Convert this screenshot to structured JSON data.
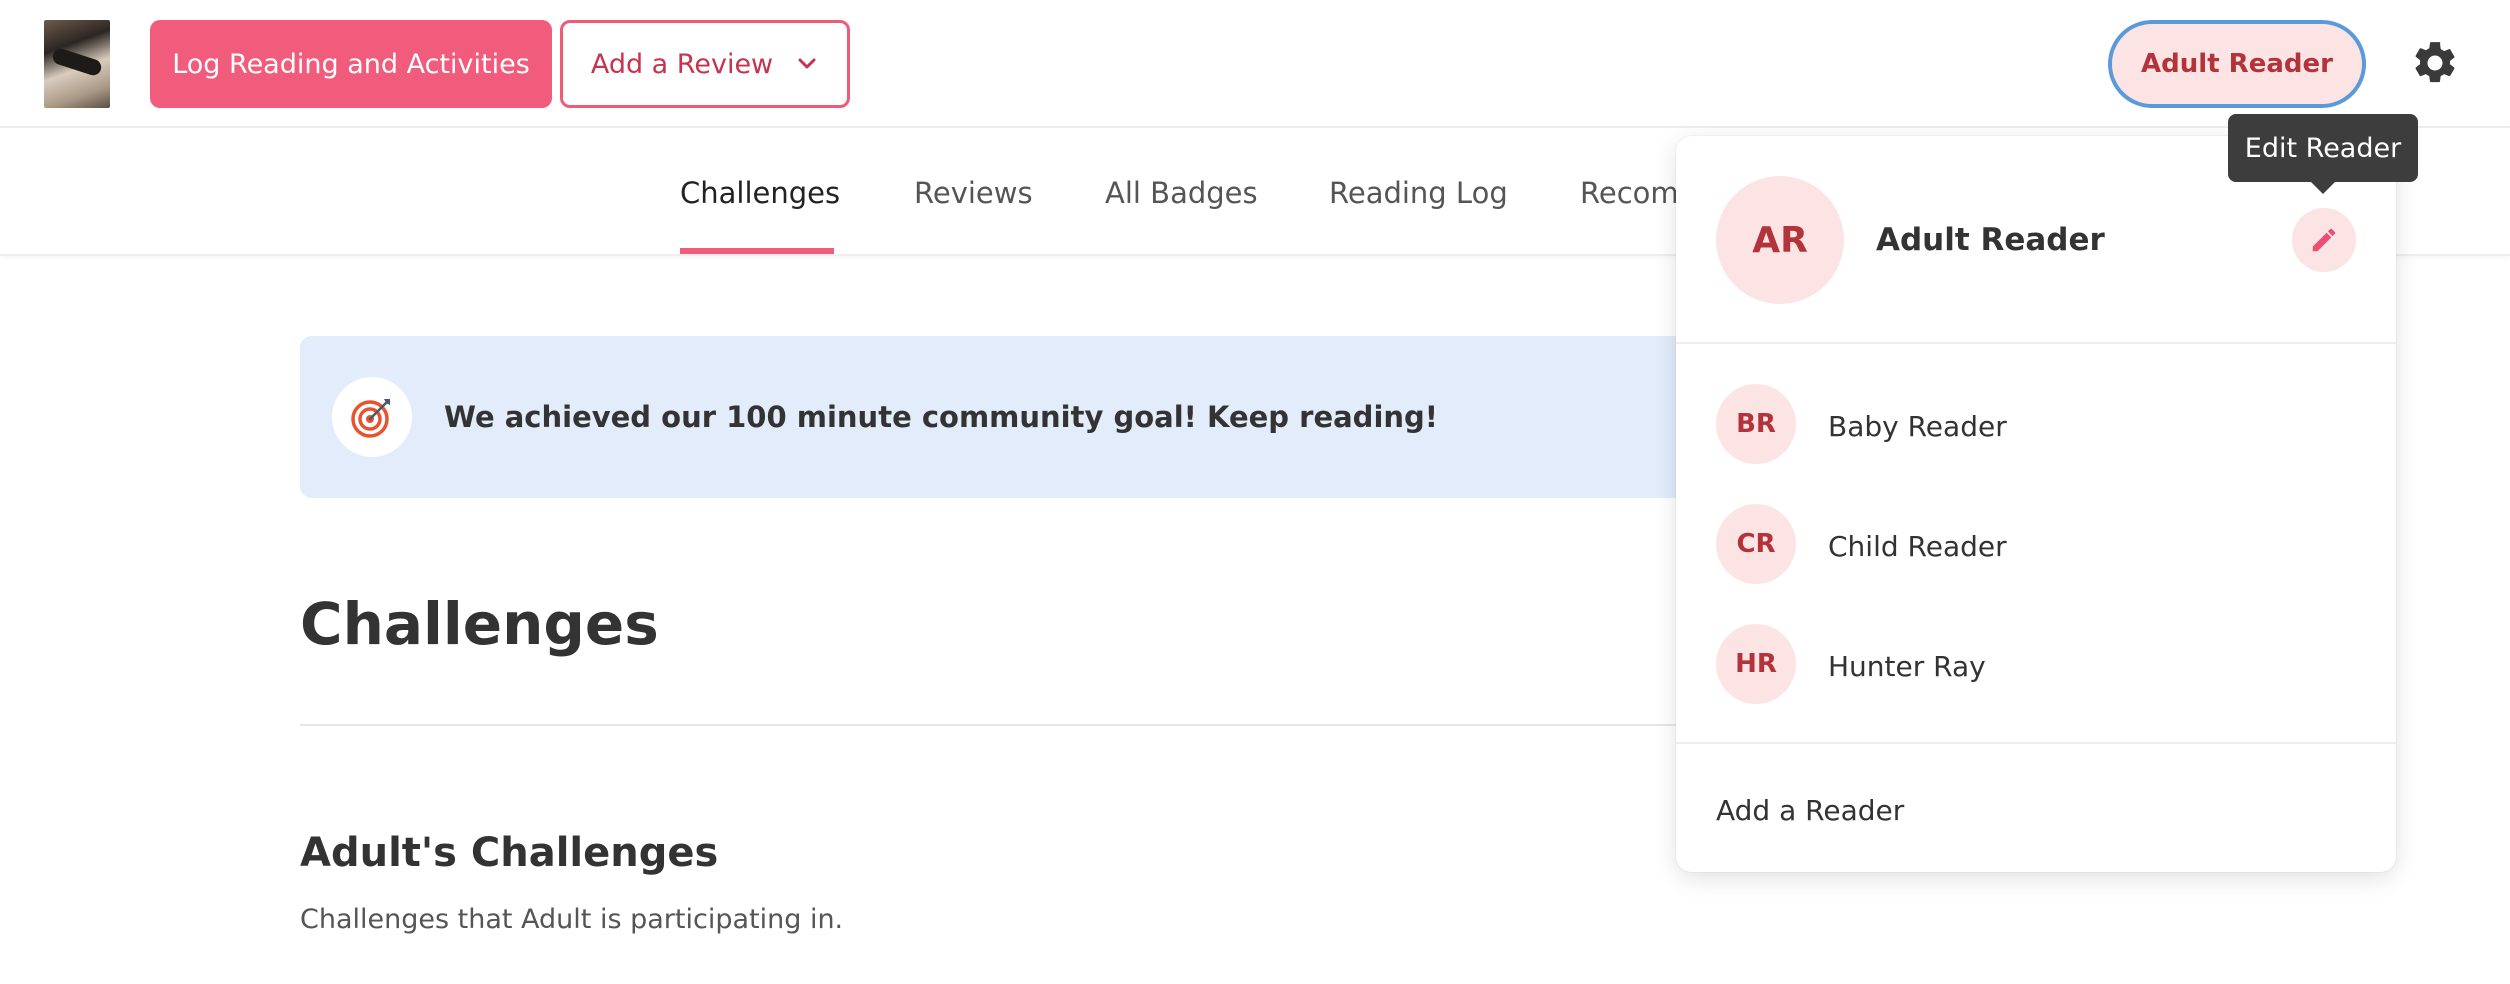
{
  "header": {
    "log_button_label": "Log Reading and Activities",
    "review_button_label": "Add a Review",
    "reader_button_label": "Adult Reader"
  },
  "nav": {
    "tabs": [
      {
        "label": "Challenges",
        "active": true
      },
      {
        "label": "Reviews",
        "active": false
      },
      {
        "label": "All Badges",
        "active": false
      },
      {
        "label": "Reading Log",
        "active": false
      },
      {
        "label": "Recom",
        "active": false
      }
    ]
  },
  "banner": {
    "text": "We achieved our 100 minute community goal! Keep reading!",
    "icon": "target-icon"
  },
  "main": {
    "page_title": "Challenges",
    "section_title": "Adult's Challenges",
    "section_subtitle": "Challenges that Adult is participating in."
  },
  "dropdown": {
    "current_reader": {
      "initials": "AR",
      "name": "Adult Reader"
    },
    "readers": [
      {
        "initials": "BR",
        "name": "Baby Reader"
      },
      {
        "initials": "CR",
        "name": "Child Reader"
      },
      {
        "initials": "HR",
        "name": "Hunter Ray"
      }
    ],
    "add_reader_label": "Add a Reader"
  },
  "tooltip": {
    "text": "Edit Reader"
  },
  "colors": {
    "accent": "#f25c7c",
    "avatar_bg": "#fce4e4",
    "avatar_text": "#b3333a",
    "banner_bg": "#e2ecfa",
    "focus_ring": "#5a9ad9"
  }
}
